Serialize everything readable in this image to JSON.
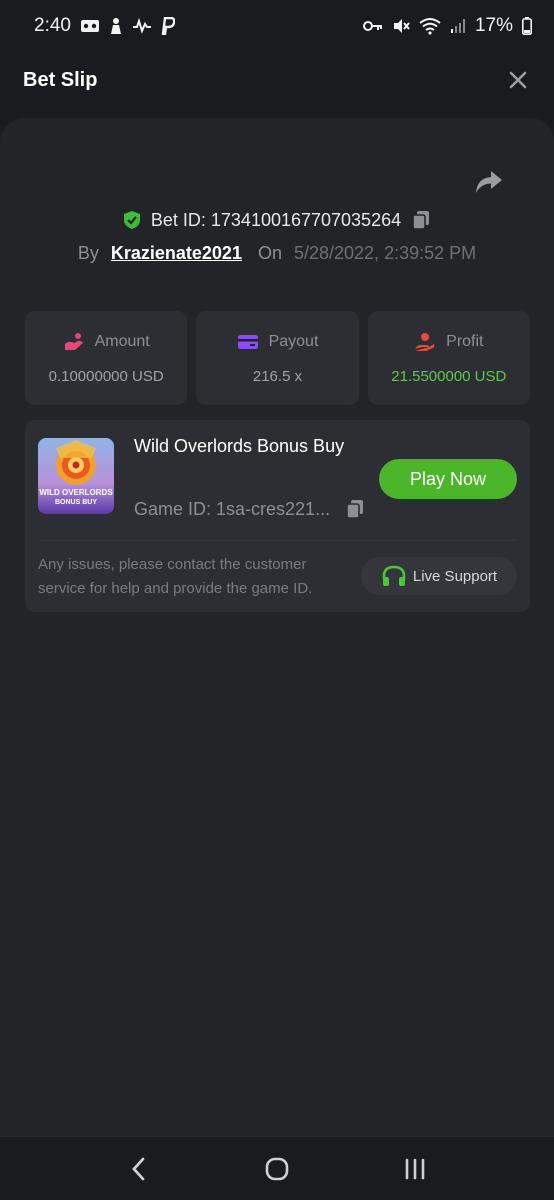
{
  "status_bar": {
    "time": "2:40",
    "left_icons": [
      "voicemail-icon",
      "person-icon",
      "signal-monitor-icon",
      "paypal-icon"
    ],
    "right_icons": [
      "key-icon",
      "mute-icon",
      "wifi-icon",
      "cell-signal-icon"
    ],
    "battery": "17%"
  },
  "header": {
    "title": "Bet Slip"
  },
  "bet": {
    "id_label": "Bet ID: 1734100167707035264",
    "by_label": "By",
    "username": "Krazienate2021",
    "on_label": "On",
    "date": "5/28/2022, 2:39:52 PM"
  },
  "stats": {
    "amount": {
      "label": "Amount",
      "value": "0.10000000 USD",
      "color": "#e8457a"
    },
    "payout": {
      "label": "Payout",
      "value": "216.5 x",
      "color": "#8e4df0"
    },
    "profit": {
      "label": "Profit",
      "value": "21.5500000 USD",
      "color": "#e84a3a"
    }
  },
  "game": {
    "title": "Wild Overlords Bonus Buy",
    "thumb_text_line1": "WILD OVERLORDS",
    "thumb_text_line2": "BONUS BUY",
    "game_id": "Game ID: 1sa-cres221...",
    "play_label": "Play Now",
    "support_text": "Any issues, please contact the customer service for help and provide the game ID.",
    "live_support_label": "Live Support"
  },
  "colors": {
    "background": "#1a1b1e",
    "sheet": "#232428",
    "card": "#2c2e33",
    "accent_green": "#4cb62b",
    "profit_green": "#5dc94b"
  }
}
